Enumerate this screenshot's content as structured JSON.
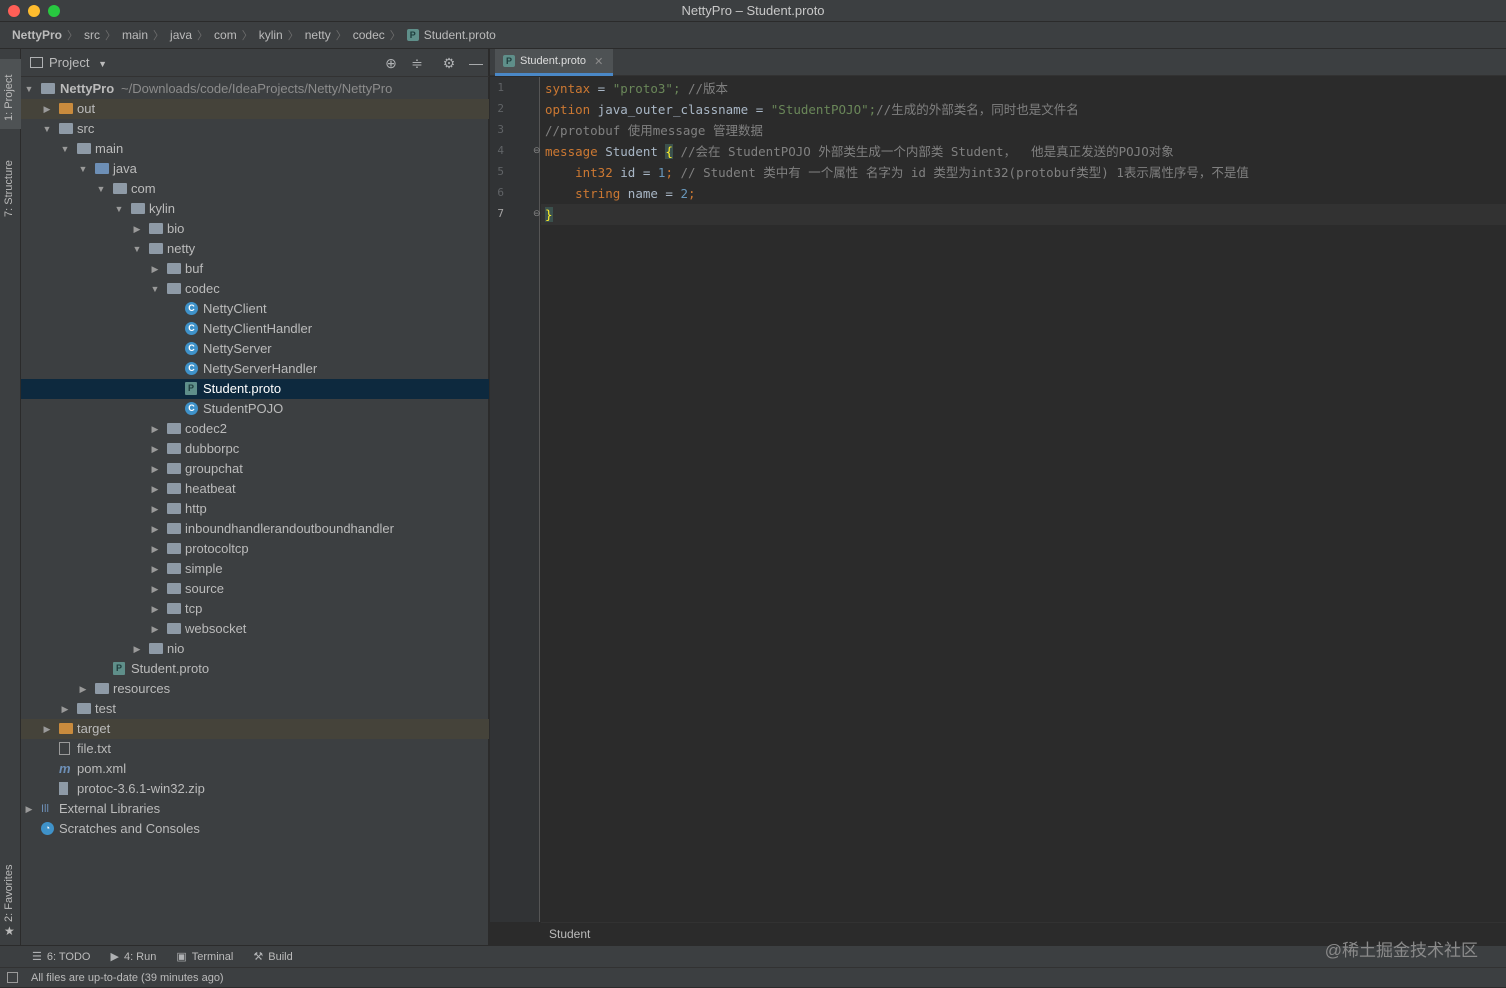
{
  "window": {
    "title": "NettyPro – Student.proto"
  },
  "breadcrumb": [
    "NettyPro",
    "src",
    "main",
    "java",
    "com",
    "kylin",
    "netty",
    "codec",
    "Student.proto"
  ],
  "left_strip": {
    "project": "1: Project",
    "structure": "7: Structure",
    "favorites": "2: Favorites"
  },
  "project_panel": {
    "title": "Project",
    "root_name": "NettyPro",
    "root_path": "~/Downloads/code/IdeaProjects/Netty/NettyPro",
    "tree": [
      {
        "label": "out",
        "depth": 1,
        "arrow": "right",
        "icon": "folder-orange",
        "state": "excluded"
      },
      {
        "label": "src",
        "depth": 1,
        "arrow": "down",
        "icon": "folder"
      },
      {
        "label": "main",
        "depth": 2,
        "arrow": "down",
        "icon": "folder"
      },
      {
        "label": "java",
        "depth": 3,
        "arrow": "down",
        "icon": "folder-blue"
      },
      {
        "label": "com",
        "depth": 4,
        "arrow": "down",
        "icon": "folder"
      },
      {
        "label": "kylin",
        "depth": 5,
        "arrow": "down",
        "icon": "folder"
      },
      {
        "label": "bio",
        "depth": 6,
        "arrow": "right",
        "icon": "folder"
      },
      {
        "label": "netty",
        "depth": 6,
        "arrow": "down",
        "icon": "folder"
      },
      {
        "label": "buf",
        "depth": 7,
        "arrow": "right",
        "icon": "folder"
      },
      {
        "label": "codec",
        "depth": 7,
        "arrow": "down",
        "icon": "folder"
      },
      {
        "label": "NettyClient",
        "depth": 8,
        "arrow": "",
        "icon": "class"
      },
      {
        "label": "NettyClientHandler",
        "depth": 8,
        "arrow": "",
        "icon": "class"
      },
      {
        "label": "NettyServer",
        "depth": 8,
        "arrow": "",
        "icon": "class"
      },
      {
        "label": "NettyServerHandler",
        "depth": 8,
        "arrow": "",
        "icon": "class"
      },
      {
        "label": "Student.proto",
        "depth": 8,
        "arrow": "",
        "icon": "proto",
        "state": "selected"
      },
      {
        "label": "StudentPOJO",
        "depth": 8,
        "arrow": "",
        "icon": "class"
      },
      {
        "label": "codec2",
        "depth": 7,
        "arrow": "right",
        "icon": "folder"
      },
      {
        "label": "dubborpc",
        "depth": 7,
        "arrow": "right",
        "icon": "folder"
      },
      {
        "label": "groupchat",
        "depth": 7,
        "arrow": "right",
        "icon": "folder"
      },
      {
        "label": "heatbeat",
        "depth": 7,
        "arrow": "right",
        "icon": "folder"
      },
      {
        "label": "http",
        "depth": 7,
        "arrow": "right",
        "icon": "folder"
      },
      {
        "label": "inboundhandlerandoutboundhandler",
        "depth": 7,
        "arrow": "right",
        "icon": "folder"
      },
      {
        "label": "protocoltcp",
        "depth": 7,
        "arrow": "right",
        "icon": "folder"
      },
      {
        "label": "simple",
        "depth": 7,
        "arrow": "right",
        "icon": "folder"
      },
      {
        "label": "source",
        "depth": 7,
        "arrow": "right",
        "icon": "folder"
      },
      {
        "label": "tcp",
        "depth": 7,
        "arrow": "right",
        "icon": "folder"
      },
      {
        "label": "websocket",
        "depth": 7,
        "arrow": "right",
        "icon": "folder"
      },
      {
        "label": "nio",
        "depth": 6,
        "arrow": "right",
        "icon": "folder"
      },
      {
        "label": "Student.proto",
        "depth": 4,
        "arrow": "",
        "icon": "proto"
      },
      {
        "label": "resources",
        "depth": 3,
        "arrow": "right",
        "icon": "folder-res"
      },
      {
        "label": "test",
        "depth": 2,
        "arrow": "right",
        "icon": "folder"
      },
      {
        "label": "target",
        "depth": 1,
        "arrow": "right",
        "icon": "folder-orange",
        "state": "excluded"
      },
      {
        "label": "file.txt",
        "depth": 1,
        "arrow": "",
        "icon": "text"
      },
      {
        "label": "pom.xml",
        "depth": 1,
        "arrow": "",
        "icon": "maven"
      },
      {
        "label": "protoc-3.6.1-win32.zip",
        "depth": 1,
        "arrow": "",
        "icon": "zip"
      },
      {
        "label": "External Libraries",
        "depth": 0,
        "arrow": "right",
        "icon": "libraries"
      },
      {
        "label": "Scratches and Consoles",
        "depth": 0,
        "arrow": "",
        "icon": "scratches"
      }
    ]
  },
  "editor": {
    "tab_label": "Student.proto",
    "tab_icon": "P",
    "current_line": 7,
    "lines": [
      [
        [
          "kw",
          "syntax"
        ],
        [
          "p",
          " = "
        ],
        [
          "str",
          "\"proto3\";"
        ],
        [
          "cm",
          " //版本"
        ]
      ],
      [
        [
          "kw",
          "option"
        ],
        [
          "p",
          " java_outer_classname = "
        ],
        [
          "str",
          "\"StudentPOJO\";"
        ],
        [
          "cm",
          "//生成的外部类名，同时也是文件名"
        ]
      ],
      [
        [
          "cm",
          "//protobuf 使用message 管理数据"
        ]
      ],
      [
        [
          "kw",
          "message"
        ],
        [
          "p",
          " Student "
        ],
        [
          "brace",
          "{"
        ],
        [
          "cm",
          " //会在 StudentPOJO 外部类生成一个内部类 Student，  他是真正发送的POJO对象"
        ]
      ],
      [
        [
          "p",
          "    "
        ],
        [
          "kw",
          "int32"
        ],
        [
          "p",
          " id = "
        ],
        [
          "num",
          "1"
        ],
        [
          "kw",
          ";"
        ],
        [
          "cm",
          " // Student 类中有 一个属性 名字为 id 类型为int32(protobuf类型) 1表示属性序号，不是值"
        ]
      ],
      [
        [
          "p",
          "    "
        ],
        [
          "kw",
          "string"
        ],
        [
          "p",
          " name = "
        ],
        [
          "num",
          "2"
        ],
        [
          "kw",
          ";"
        ]
      ],
      [
        [
          "brace",
          "}"
        ]
      ]
    ],
    "breadcrumb_status": "Student"
  },
  "bottom_tools": [
    {
      "icon": "list-icon",
      "glyph": "☰",
      "label": "6: TODO"
    },
    {
      "icon": "run-icon",
      "glyph": "▶",
      "label": "4: Run"
    },
    {
      "icon": "terminal-icon",
      "glyph": "▣",
      "label": "Terminal"
    },
    {
      "icon": "build-icon",
      "glyph": "⚒",
      "label": "Build"
    }
  ],
  "status": {
    "message": "All files are up-to-date (39 minutes ago)"
  },
  "watermark": "@稀土掘金技术社区",
  "colors": {
    "selection": "#0d293e",
    "keyword": "#cc7832",
    "string": "#6a8759",
    "comment": "#808080",
    "number": "#6897bb",
    "excluded_row": "#45433a"
  }
}
